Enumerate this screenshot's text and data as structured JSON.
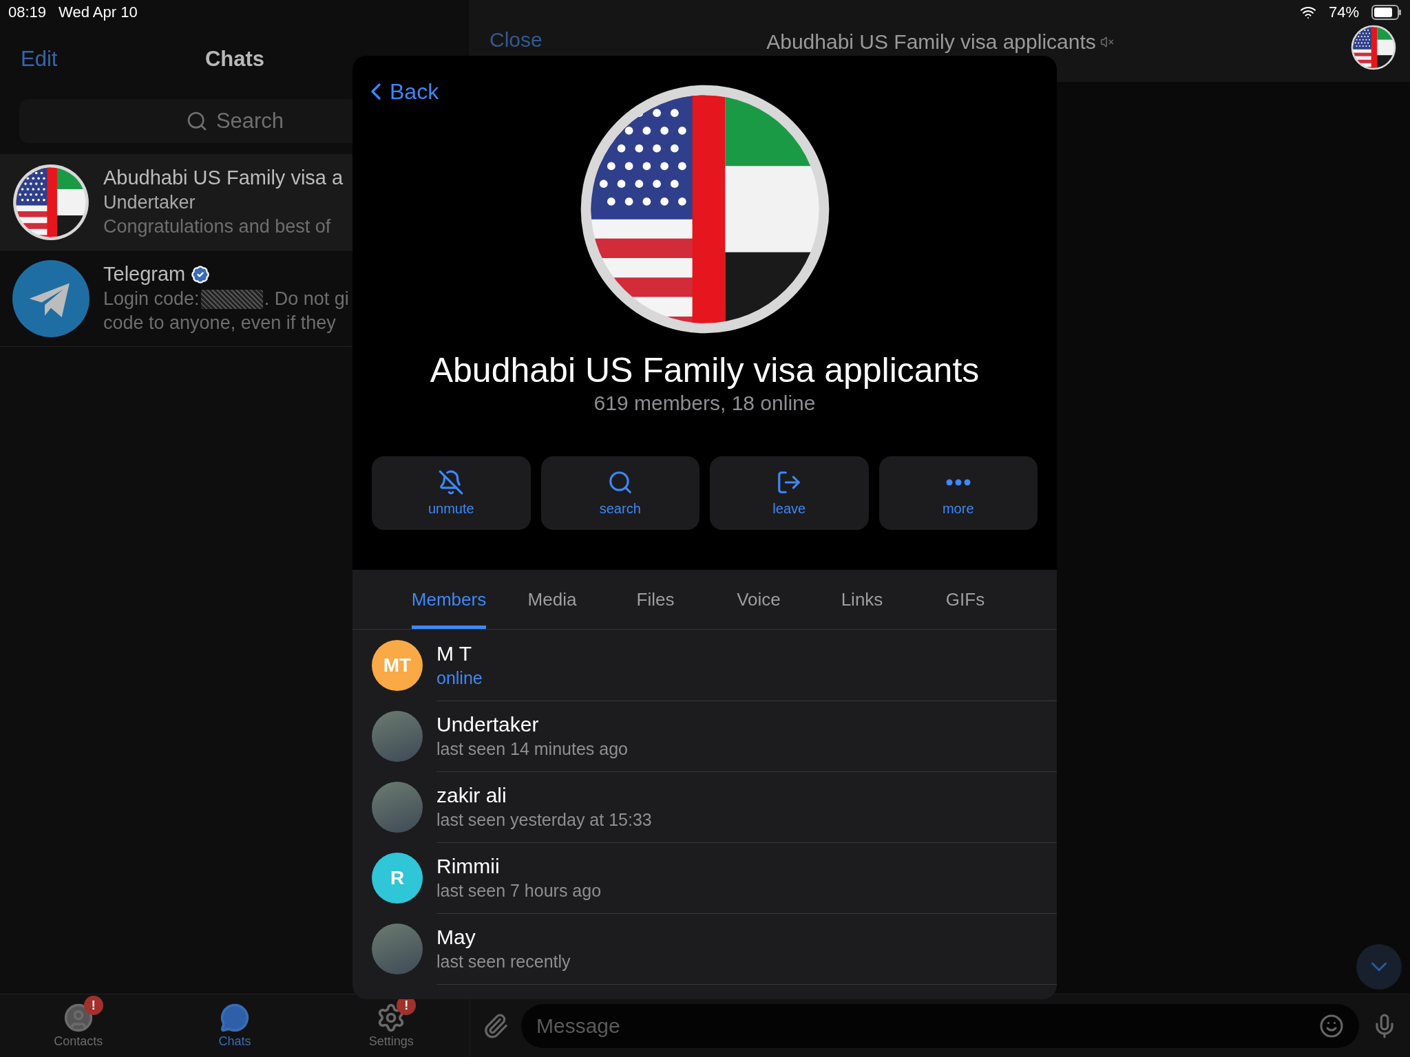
{
  "status_bar": {
    "time": "08:19",
    "date": "Wed Apr 10",
    "battery": "74%"
  },
  "chats_panel": {
    "edit": "Edit",
    "title": "Chats",
    "search_placeholder": "Search",
    "chats": [
      {
        "kind": "group",
        "title": "Abudhabi US Family visa a",
        "sender": "Undertaker",
        "preview": "Congratulations and best of",
        "selected": true
      },
      {
        "kind": "service",
        "title": "Telegram",
        "verified": true,
        "preview_before": "Login code:",
        "preview_after": ". Do not gi",
        "preview_line2": "code to anyone, even if they",
        "selected": false
      }
    ]
  },
  "tab_bar": [
    {
      "kind": "contacts",
      "label": "Contacts",
      "badge": "!",
      "selected": false
    },
    {
      "kind": "chats",
      "label": "Chats",
      "selected": true
    },
    {
      "kind": "settings",
      "label": "Settings",
      "badge": "!",
      "selected": false
    }
  ],
  "chat": {
    "close": "Close",
    "title": "Abudhabi US Family visa applicants",
    "muted": true,
    "message_placeholder": "Message"
  },
  "group_info": {
    "back": "Back",
    "name": "Abudhabi US Family visa applicants",
    "subtitle": "619 members, 18 online",
    "actions": [
      {
        "kind": "unmute",
        "label": "unmute"
      },
      {
        "kind": "search",
        "label": "search"
      },
      {
        "kind": "leave",
        "label": "leave"
      },
      {
        "kind": "more",
        "label": "more"
      }
    ],
    "tabs": [
      {
        "label": "Members",
        "selected": true
      },
      {
        "label": "Media",
        "selected": false
      },
      {
        "label": "Files",
        "selected": false
      },
      {
        "label": "Voice",
        "selected": false
      },
      {
        "label": "Links",
        "selected": false
      },
      {
        "label": "GIFs",
        "selected": false
      }
    ],
    "members": [
      {
        "name": "M T",
        "status": "online",
        "online": true,
        "avatar": {
          "kind": "initials",
          "initials": "MT",
          "color": "#f9a945"
        }
      },
      {
        "name": "Undertaker",
        "status": "last seen 14 minutes ago",
        "online": false,
        "avatar": {
          "kind": "photo"
        }
      },
      {
        "name": "zakir ali",
        "status": "last seen yesterday at 15:33",
        "online": false,
        "avatar": {
          "kind": "photo"
        }
      },
      {
        "name": "Rimmii",
        "status": "last seen 7 hours ago",
        "online": false,
        "avatar": {
          "kind": "initials",
          "initials": "R",
          "color": "#2fc6d8"
        }
      },
      {
        "name": "May",
        "status": "last seen recently",
        "online": false,
        "avatar": {
          "kind": "photo"
        }
      }
    ]
  }
}
